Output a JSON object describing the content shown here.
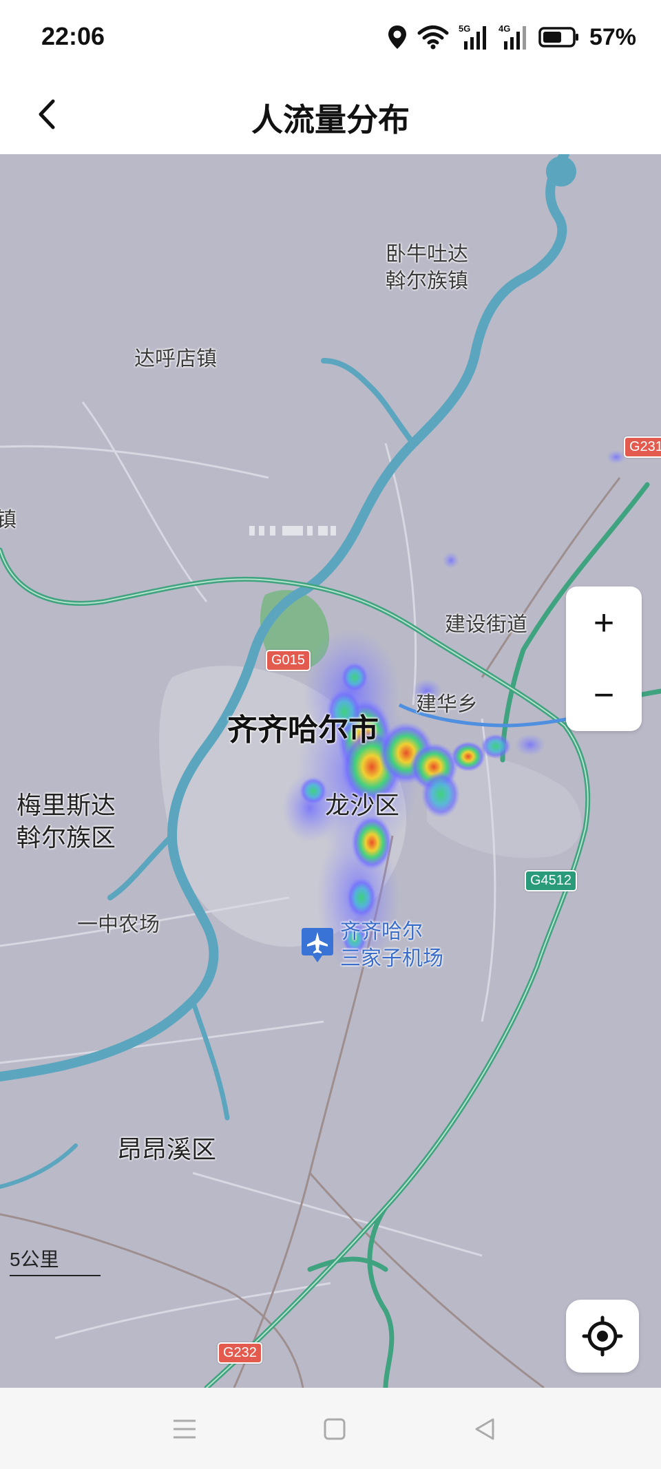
{
  "status_bar": {
    "time": "22:06",
    "battery": "57%",
    "net_5g": "5G",
    "net_4g": "4G",
    "icons": [
      "location-icon",
      "wifi-icon",
      "signal-5g-icon",
      "signal-4g-icon",
      "battery-icon"
    ]
  },
  "header": {
    "title": "人流量分布",
    "back_icon": "chevron-left-icon"
  },
  "map": {
    "labels": {
      "wotu_1": "卧牛吐达",
      "wotu_2": "斡尔族镇",
      "dahu": "达呼店镇",
      "zhen": "镇",
      "jianshe": "建设街道",
      "jianhua": "建华乡",
      "city": "齐齐哈尔市",
      "longsha": "龙沙区",
      "meili_1": "梅里斯达",
      "meili_2": "斡尔族区",
      "yizhong": "一中农场",
      "airport_1": "齐齐哈尔",
      "airport_2": "三家子机场",
      "angangxi": "昂昂溪区"
    },
    "road_badges": {
      "g015": "G015",
      "g231": "G231",
      "g4512": "G4512",
      "g232": "G232"
    },
    "zoom_in": "+",
    "zoom_out": "−",
    "scale": "5公里",
    "colors": {
      "land": "#b9b9c8",
      "water": "#5ba6be",
      "highway": "#3ea37e",
      "heat_low": "#6f6cff",
      "heat_mid": "#3fd27a",
      "heat_high": "#f0d033",
      "heat_peak": "#e8502a"
    }
  },
  "system_nav": {
    "icons": [
      "menu-icon",
      "home-square-icon",
      "back-triangle-icon"
    ]
  }
}
